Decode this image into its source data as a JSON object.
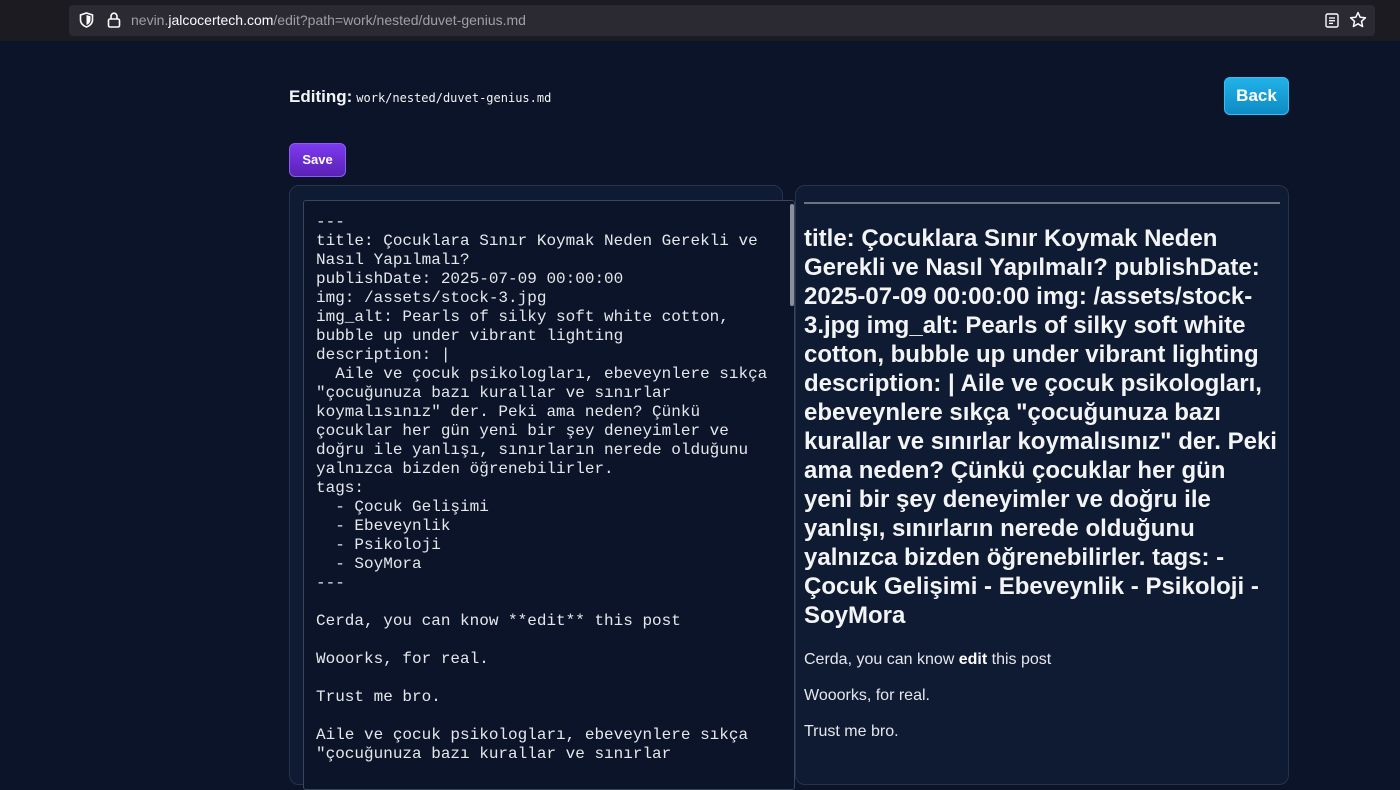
{
  "browser": {
    "url_prefix": "nevin.",
    "url_host": "jalcocertech.com",
    "url_path": "/edit?path=work/nested/duvet-genius.md",
    "icons": [
      "shield-icon",
      "lock-icon",
      "reader-view-icon",
      "bookmark-star-icon"
    ]
  },
  "header": {
    "editing_label": "Editing:",
    "file_path": "work/nested/duvet-genius.md",
    "back_label": "Back"
  },
  "toolbar": {
    "save_label": "Save"
  },
  "colors": {
    "background": "#0b1428",
    "panel": "#0f1a33",
    "back_button": "#0ea5e9",
    "save_button": "#6d28d9"
  },
  "editor": {
    "content": "---\ntitle: Çocuklara Sınır Koymak Neden Gerekli ve Nasıl Yapılmalı?\npublishDate: 2025-07-09 00:00:00\nimg: /assets/stock-3.jpg\nimg_alt: Pearls of silky soft white cotton, bubble up under vibrant lighting\ndescription: |\n  Aile ve çocuk psikologları, ebeveynlere sıkça \"çocuğunuza bazı kurallar ve sınırlar koymalısınız\" der. Peki ama neden? Çünkü çocuklar her gün yeni bir şey deneyimler ve doğru ile yanlışı, sınırların nerede olduğunu yalnızca bizden öğrenebilirler.\ntags:\n  - Çocuk Gelişimi\n  - Ebeveynlik\n  - Psikoloji\n  - SoyMora\n---\n\nCerda, you can know **edit** this post\n\nWooorks, for real.\n\nTrust me bro.\n\nAile ve çocuk psikologları, ebeveynlere sıkça \"çocuğunuza bazı kurallar ve sınırlar"
  },
  "preview": {
    "heading": "title: Çocuklara Sınır Koymak Neden Gerekli ve Nasıl Yapılmalı? publishDate: 2025-07-09 00:00:00 img: /assets/stock-3.jpg img_alt: Pearls of silky soft white cotton, bubble up under vibrant lighting description: | Aile ve çocuk psikologları, ebeveynlere sıkça \"çocuğunuza bazı kurallar ve sınırlar koymalısınız\" der. Peki ama neden? Çünkü çocuklar her gün yeni bir şey deneyimler ve doğru ile yanlışı, sınırların nerede olduğunu yalnızca bizden öğrenebilirler. tags: - Çocuk Gelişimi - Ebeveynlik - Psikoloji - SoyMora",
    "para1_before": "Cerda, you can know ",
    "para1_bold": "edit",
    "para1_after": " this post",
    "para2": "Wooorks, for real.",
    "para3": "Trust me bro."
  }
}
